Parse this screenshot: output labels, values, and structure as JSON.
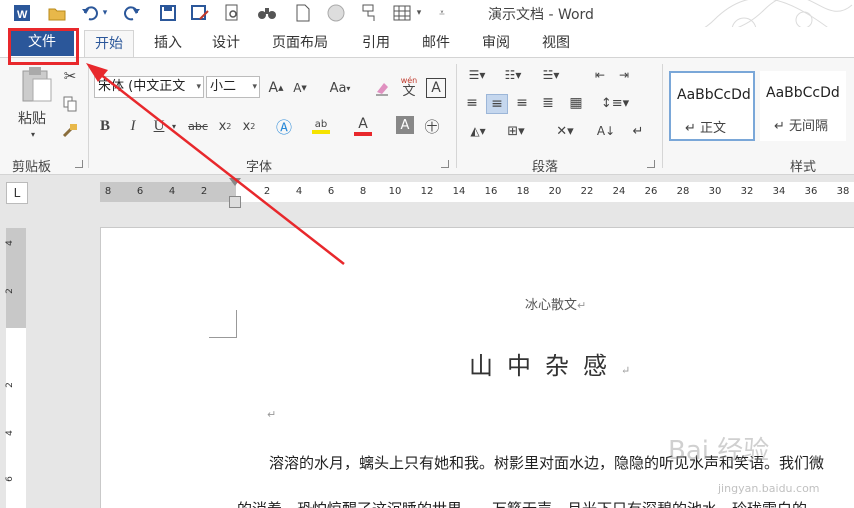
{
  "window": {
    "title": "演示文档 - Word"
  },
  "quick_access": {
    "word_icon": "word-icon",
    "items": [
      "folder-icon",
      "undo-icon",
      "redo-icon",
      "save-icon",
      "save-as-icon",
      "print-preview-icon",
      "find-icon",
      "new-doc-icon",
      "record-icon",
      "format-painter-icon",
      "table-icon",
      "customize-icon"
    ]
  },
  "tabs": {
    "file": "文件",
    "home": "开始",
    "insert": "插入",
    "design": "设计",
    "layout": "页面布局",
    "references": "引用",
    "mailings": "邮件",
    "review": "审阅",
    "view": "视图"
  },
  "ribbon": {
    "clipboard": {
      "paste": "粘贴",
      "label": "剪贴板"
    },
    "font": {
      "name": "宋体 (中文正文",
      "size": "小二",
      "aa": "Aa",
      "wen": "wén",
      "wen_char": "文",
      "label": "字体"
    },
    "paragraph": {
      "label": "段落"
    },
    "styles": {
      "label": "样式",
      "items": [
        {
          "preview": "AaBbCcDd",
          "name": "正文"
        },
        {
          "preview": "AaBbCcDd",
          "name": "无间隔"
        }
      ]
    }
  },
  "ruler": {
    "left_numbers": [
      "8",
      "6",
      "4",
      "2"
    ],
    "numbers": [
      "2",
      "4",
      "6",
      "8",
      "10",
      "12",
      "14",
      "16",
      "18",
      "20",
      "22",
      "24",
      "26",
      "28",
      "30",
      "32",
      "34",
      "36",
      "38"
    ],
    "corner": "L"
  },
  "vruler": {
    "numbers": [
      "4",
      "2",
      "2",
      "4",
      "6"
    ]
  },
  "document": {
    "author": "冰心散文",
    "title": "山中杂感",
    "line1": "溶溶的水月，螭头上只有她和我。树影里对面水边，隐隐的听见水声和笑语。我们微",
    "line2": "的消着，恐怕惊醒了这沉睡的世界……万籁无声，月光下只有深碧的池水，玲珑雪白的"
  },
  "watermark": {
    "text": "Bai 经验",
    "sub": "jingyan.baidu.com"
  },
  "colors": {
    "file_tab": "#2b579a",
    "highlight": "#e8282c",
    "arrow": "#e8282c"
  }
}
